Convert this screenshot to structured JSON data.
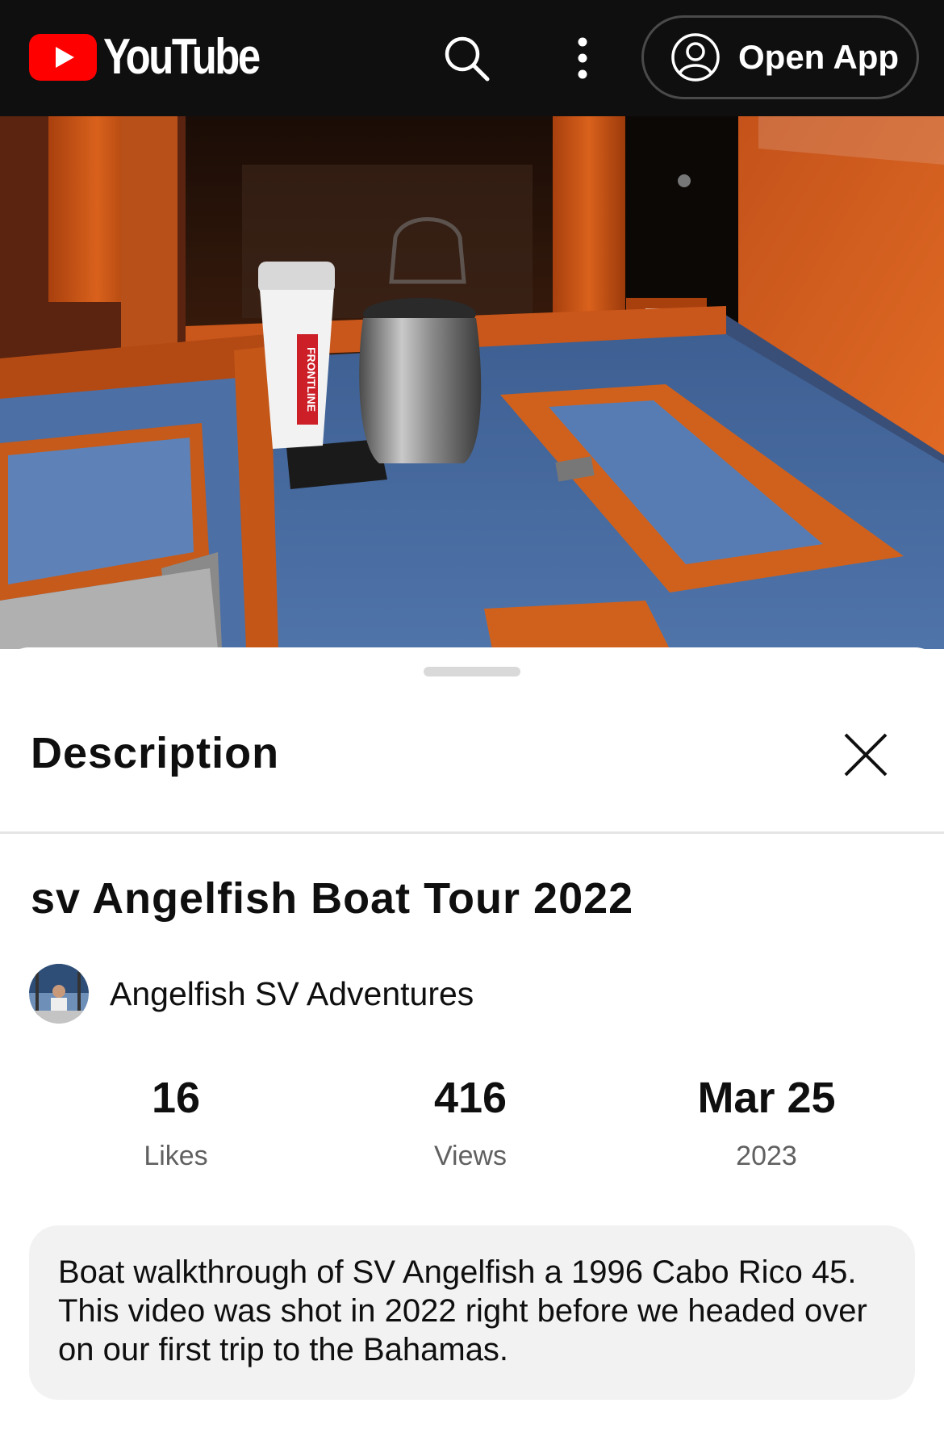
{
  "header": {
    "logo_text": "YouTube",
    "open_app_label": "Open App",
    "icons": [
      "youtube-play-icon",
      "search-icon",
      "more-vertical-icon",
      "account-circle-icon"
    ]
  },
  "video": {
    "thumbnail_text": "FRONTLINE"
  },
  "panel": {
    "title": "Description",
    "close_icon": "close-icon"
  },
  "details": {
    "video_title": "sv Angelfish Boat Tour 2022",
    "channel_name": "Angelfish SV Adventures",
    "stats": [
      {
        "value": "16",
        "label": "Likes"
      },
      {
        "value": "416",
        "label": "Views"
      },
      {
        "value": "Mar 25",
        "label": "2023"
      }
    ],
    "description": "Boat walkthrough of SV Angelfish a 1996 Cabo Rico 45. This video was shot in 2022 right before we headed over on our first trip to the Bahamas."
  },
  "colors": {
    "topbar": "#0f0f0f",
    "brand_red": "#ff0000",
    "text_primary": "#0f0f0f",
    "text_secondary": "#606060",
    "description_bg": "#f2f2f2"
  }
}
